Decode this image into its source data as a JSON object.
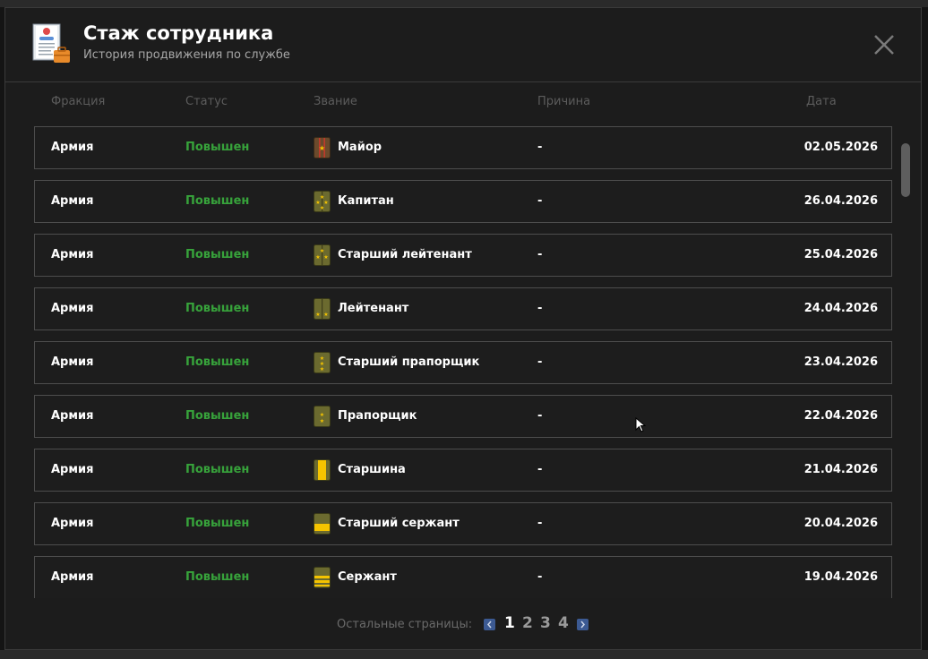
{
  "window": {
    "title": "Стаж сотрудника",
    "subtitle": "История продвижения по службе"
  },
  "columns": {
    "faction": "Фракция",
    "status": "Статус",
    "rank": "Звание",
    "reason": "Причина",
    "date": "Дата"
  },
  "rows": [
    {
      "faction": "Армия",
      "status": "Повышен",
      "rank": "Майор",
      "rank_icon": "major-insignia-icon",
      "reason": "-",
      "date": "02.05.2026"
    },
    {
      "faction": "Армия",
      "status": "Повышен",
      "rank": "Капитан",
      "rank_icon": "captain-insignia-icon",
      "reason": "-",
      "date": "26.04.2026"
    },
    {
      "faction": "Армия",
      "status": "Повышен",
      "rank": "Старший лейтенант",
      "rank_icon": "senior-lieutenant-insignia-icon",
      "reason": "-",
      "date": "25.04.2026"
    },
    {
      "faction": "Армия",
      "status": "Повышен",
      "rank": "Лейтенант",
      "rank_icon": "lieutenant-insignia-icon",
      "reason": "-",
      "date": "24.04.2026"
    },
    {
      "faction": "Армия",
      "status": "Повышен",
      "rank": "Старший прапорщик",
      "rank_icon": "senior-warrant-officer-insignia-icon",
      "reason": "-",
      "date": "23.04.2026"
    },
    {
      "faction": "Армия",
      "status": "Повышен",
      "rank": "Прапорщик",
      "rank_icon": "warrant-officer-insignia-icon",
      "reason": "-",
      "date": "22.04.2026"
    },
    {
      "faction": "Армия",
      "status": "Повышен",
      "rank": "Старшина",
      "rank_icon": "petty-officer-insignia-icon",
      "reason": "-",
      "date": "21.04.2026"
    },
    {
      "faction": "Армия",
      "status": "Повышен",
      "rank": "Старший сержант",
      "rank_icon": "senior-sergeant-insignia-icon",
      "reason": "-",
      "date": "20.04.2026"
    },
    {
      "faction": "Армия",
      "status": "Повышен",
      "rank": "Сержант",
      "rank_icon": "sergeant-insignia-icon",
      "reason": "-",
      "date": "19.04.2026"
    }
  ],
  "pagination": {
    "label": "Остальные страницы:",
    "pages": [
      "1",
      "2",
      "3",
      "4"
    ],
    "current": "1"
  },
  "colors": {
    "status_promoted": "#37a33b",
    "page_arrow": "#3c5a93",
    "insignia_gold": "#f5c400",
    "insignia_olive": "#6b6a2f",
    "insignia_brown": "#6b4a2c"
  },
  "icons": {
    "header": "document-briefcase-icon",
    "close": "close-icon",
    "prev": "chevron-left-icon",
    "next": "chevron-right-icon"
  }
}
